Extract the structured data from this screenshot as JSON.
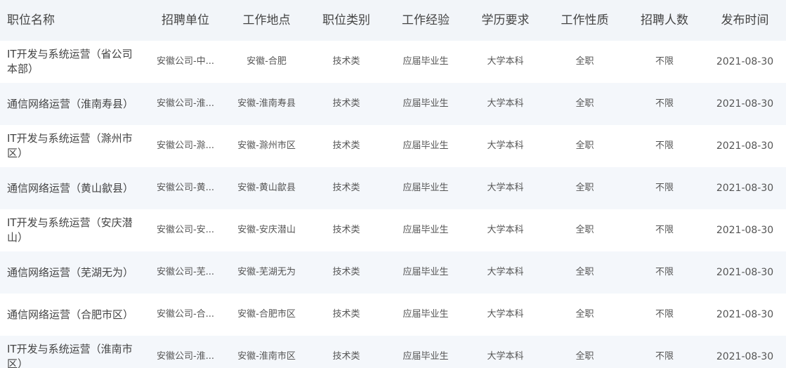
{
  "header": {
    "title": "职位名称",
    "unit": "招聘单位",
    "location": "工作地点",
    "category": "职位类别",
    "experience": "工作经验",
    "education": "学历要求",
    "job_type": "工作性质",
    "headcount": "招聘人数",
    "date": "发布时间"
  },
  "rows": [
    {
      "title": "IT开发与系统运营（省公司本部）",
      "unit": "安徽公司-中...",
      "location": "安徽-合肥",
      "category": "技术类",
      "experience": "应届毕业生",
      "education": "大学本科",
      "job_type": "全职",
      "headcount": "不限",
      "date": "2021-08-30"
    },
    {
      "title": "通信网络运营（淮南寿县）",
      "unit": "安徽公司-淮...",
      "location": "安徽-淮南寿县",
      "category": "技术类",
      "experience": "应届毕业生",
      "education": "大学本科",
      "job_type": "全职",
      "headcount": "不限",
      "date": "2021-08-30"
    },
    {
      "title": "IT开发与系统运营（滁州市区）",
      "unit": "安徽公司-滁...",
      "location": "安徽-滁州市区",
      "category": "技术类",
      "experience": "应届毕业生",
      "education": "大学本科",
      "job_type": "全职",
      "headcount": "不限",
      "date": "2021-08-30"
    },
    {
      "title": "通信网络运营（黄山歙县）",
      "unit": "安徽公司-黄...",
      "location": "安徽-黄山歙县",
      "category": "技术类",
      "experience": "应届毕业生",
      "education": "大学本科",
      "job_type": "全职",
      "headcount": "不限",
      "date": "2021-08-30"
    },
    {
      "title": "IT开发与系统运营（安庆潜山）",
      "unit": "安徽公司-安...",
      "location": "安徽-安庆潜山",
      "category": "技术类",
      "experience": "应届毕业生",
      "education": "大学本科",
      "job_type": "全职",
      "headcount": "不限",
      "date": "2021-08-30"
    },
    {
      "title": "通信网络运营（芜湖无为）",
      "unit": "安徽公司-芜...",
      "location": "安徽-芜湖无为",
      "category": "技术类",
      "experience": "应届毕业生",
      "education": "大学本科",
      "job_type": "全职",
      "headcount": "不限",
      "date": "2021-08-30"
    },
    {
      "title": "通信网络运营（合肥市区）",
      "unit": "安徽公司-合...",
      "location": "安徽-合肥市区",
      "category": "技术类",
      "experience": "应届毕业生",
      "education": "大学本科",
      "job_type": "全职",
      "headcount": "不限",
      "date": "2021-08-30"
    },
    {
      "title": "IT开发与系统运营（淮南市区）",
      "unit": "安徽公司-淮...",
      "location": "安徽-淮南市区",
      "category": "技术类",
      "experience": "应届毕业生",
      "education": "大学本科",
      "job_type": "全职",
      "headcount": "不限",
      "date": "2021-08-30"
    }
  ]
}
